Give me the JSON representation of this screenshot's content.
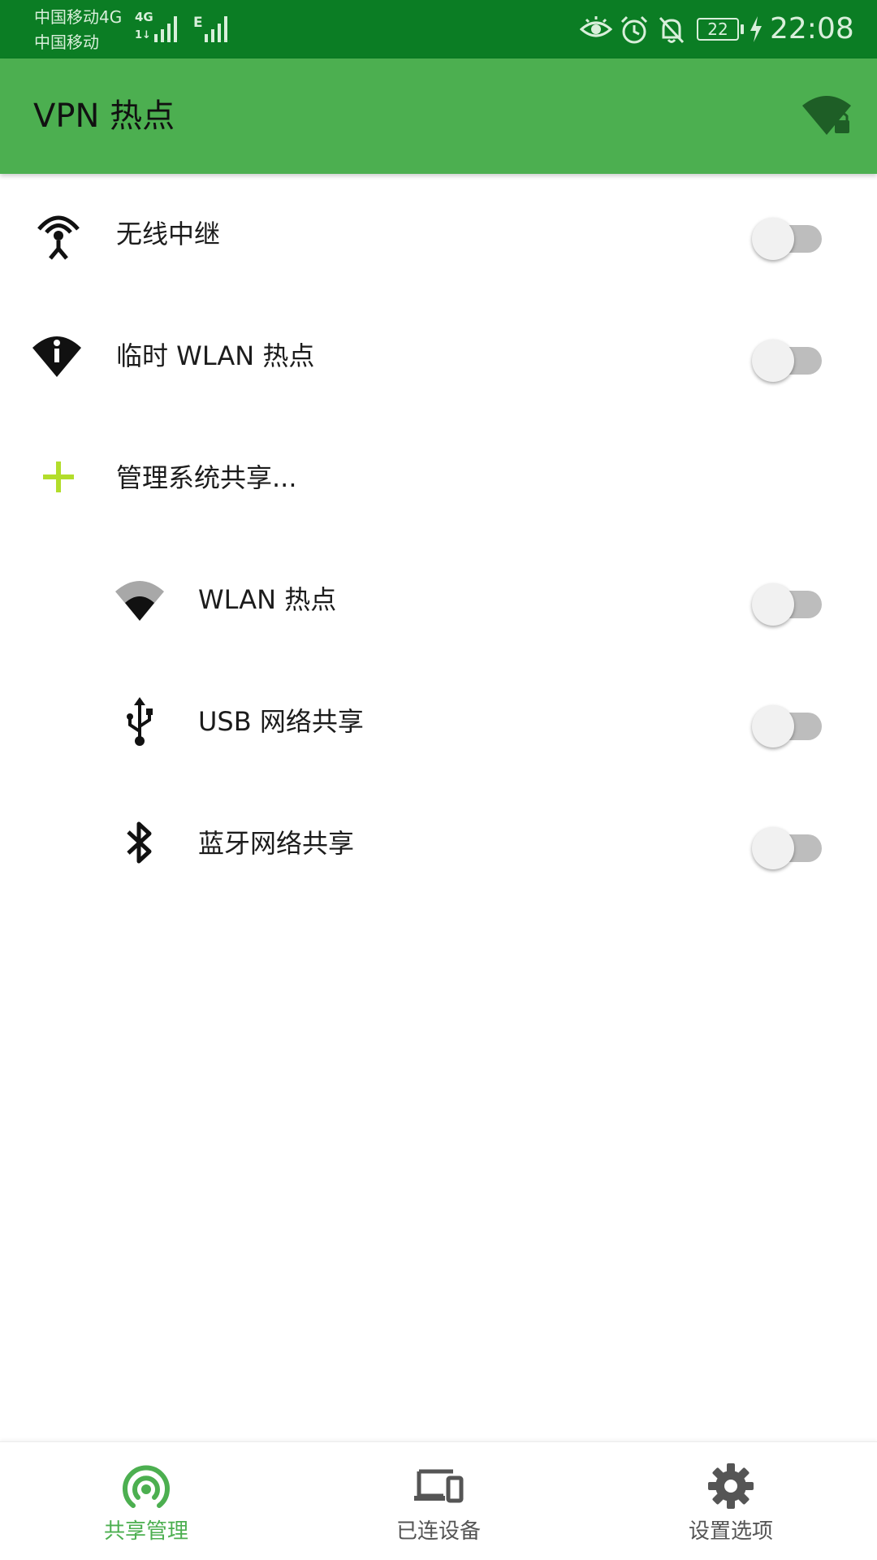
{
  "status_bar": {
    "carrier_line1": "中国移动4G",
    "carrier_line2": "中国移动",
    "net_type_1": "4G",
    "net_type_1b": "1↓",
    "net_type_2": "E",
    "battery_level": "22",
    "time": "22:08"
  },
  "app_bar": {
    "title": "VPN 热点"
  },
  "list": {
    "items": [
      {
        "label": "无线中继",
        "enabled": false
      },
      {
        "label": "临时 WLAN 热点",
        "enabled": false
      },
      {
        "label": "管理系统共享..."
      },
      {
        "label": "WLAN 热点",
        "enabled": false
      },
      {
        "label": "USB 网络共享",
        "enabled": false
      },
      {
        "label": "蓝牙网络共享",
        "enabled": false
      }
    ]
  },
  "bottom_nav": {
    "items": [
      {
        "label": "共享管理",
        "active": true
      },
      {
        "label": "已连设备",
        "active": false
      },
      {
        "label": "设置选项",
        "active": false
      }
    ]
  },
  "colors": {
    "status_bar": "#0b7d24",
    "app_bar": "#4caf50",
    "accent_green": "#4caf50",
    "add_icon_lime": "#b2dd2b",
    "toggle_off_track": "#bdbdbd"
  },
  "icons": {
    "app_action": "wifi-lock-icon",
    "repeater": "antenna-icon",
    "temp_hotspot": "wifi-info-icon",
    "manage": "plus-icon",
    "wlan": "wifi-icon",
    "usb": "usb-icon",
    "bluetooth": "bluetooth-icon",
    "nav_share": "hotspot-icon",
    "nav_devices": "devices-icon",
    "nav_settings": "gear-icon"
  }
}
